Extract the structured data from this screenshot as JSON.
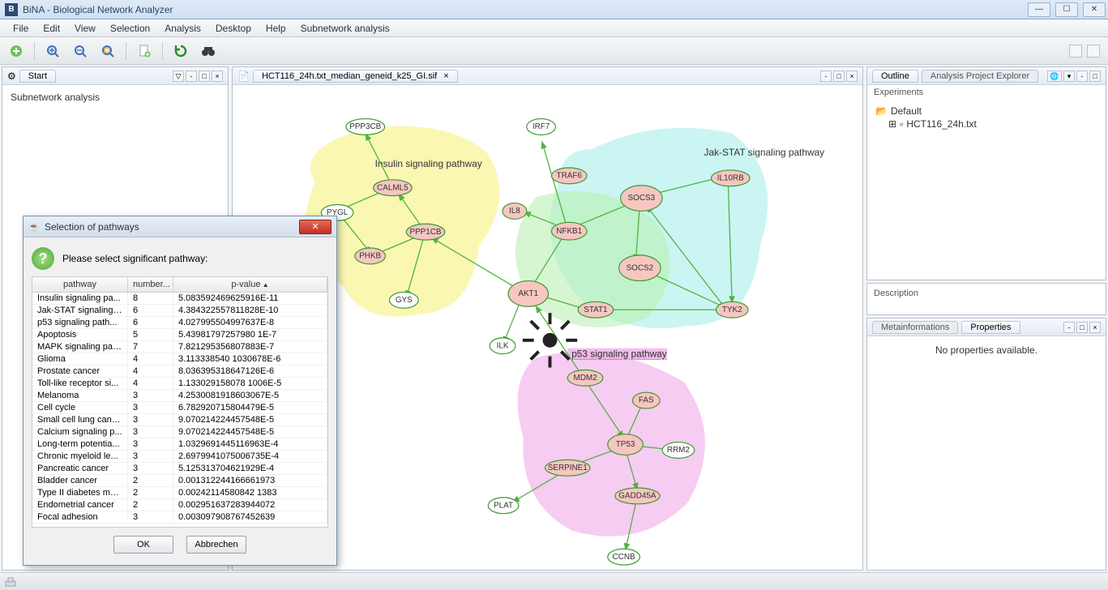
{
  "app": {
    "title": "BiNA - Biological Network Analyzer"
  },
  "menubar": {
    "items": [
      "File",
      "Edit",
      "View",
      "Selection",
      "Analysis",
      "Desktop",
      "Help",
      "Subnetwork analysis"
    ]
  },
  "left": {
    "tab": "Start",
    "body": "Subnetwork analysis"
  },
  "center": {
    "tab": "HCT116_24h.txt_median_geneid_k25_GI.sif"
  },
  "right": {
    "tabs": {
      "outline": "Outline",
      "analysis": "Analysis Project Explorer"
    },
    "experiments_label": "Experiments",
    "tree": {
      "default": "Default",
      "file": "HCT116_24h.txt"
    },
    "description_label": "Description",
    "properties_tabs": {
      "meta": "Metainformations",
      "props": "Properties"
    },
    "properties_body": "No properties available."
  },
  "dialog": {
    "title": "Selection of pathways",
    "prompt": "Please select significant pathway:",
    "columns": {
      "pathway": "pathway",
      "number": "number...",
      "pvalue": "p-value"
    },
    "rows": [
      {
        "pathway": "Insulin signaling pa...",
        "number": "8",
        "pvalue": "5.083592469625916E-11"
      },
      {
        "pathway": "Jak-STAT signaling ...",
        "number": "6",
        "pvalue": "4.384322557811828E-10"
      },
      {
        "pathway": "p53 signaling path...",
        "number": "6",
        "pvalue": "4.027995504997637E-8"
      },
      {
        "pathway": "Apoptosis",
        "number": "5",
        "pvalue": "5.43981797257980 1E-7"
      },
      {
        "pathway": "MAPK signaling pat...",
        "number": "7",
        "pvalue": "7.821295356807883E-7"
      },
      {
        "pathway": "Glioma",
        "number": "4",
        "pvalue": "3.113338540 1030678E-6"
      },
      {
        "pathway": "Prostate cancer",
        "number": "4",
        "pvalue": "8.036395318647126E-6"
      },
      {
        "pathway": "Toll-like receptor si...",
        "number": "4",
        "pvalue": "1.133029158078 1006E-5"
      },
      {
        "pathway": "Melanoma",
        "number": "3",
        "pvalue": "4.2530081918603067E-5"
      },
      {
        "pathway": "Cell cycle",
        "number": "3",
        "pvalue": "6.782920715804479E-5"
      },
      {
        "pathway": "Small cell lung canc...",
        "number": "3",
        "pvalue": "9.070214224457548E-5"
      },
      {
        "pathway": "Calcium signaling p...",
        "number": "3",
        "pvalue": "9.070214224457548E-5"
      },
      {
        "pathway": "Long-term potentia...",
        "number": "3",
        "pvalue": "1.0329691445116963E-4"
      },
      {
        "pathway": "Chronic myeloid le...",
        "number": "3",
        "pvalue": "2.6979941075006735E-4"
      },
      {
        "pathway": "Pancreatic cancer",
        "number": "3",
        "pvalue": "5.125313704621929E-4"
      },
      {
        "pathway": "Bladder cancer",
        "number": "2",
        "pvalue": "0.001312244166661973"
      },
      {
        "pathway": "Type II diabetes mel...",
        "number": "2",
        "pvalue": "0.00242114580842 1383"
      },
      {
        "pathway": "Endometrial cancer",
        "number": "2",
        "pvalue": "0.002951637283944072"
      },
      {
        "pathway": "Focal adhesion",
        "number": "3",
        "pvalue": "0.003097908767452639"
      }
    ],
    "ok": "OK",
    "cancel": "Abbrechen"
  },
  "network": {
    "regions": {
      "insulin": "Insulin signaling pathway",
      "jakstat": "Jak-STAT signaling pathway",
      "p53": "p53 signaling pathway"
    },
    "nodes": {
      "PPP3CB": "PPP3CB",
      "IRF7": "IRF7",
      "CALML5": "CALML5",
      "TRAF6": "TRAF6",
      "SOCS3": "SOCS3",
      "IL10RB": "IL10RB",
      "PYGL": "PYGL",
      "IL8": "IL8",
      "PPP1CB": "PPP1CB",
      "NFKB1": "NFKB1",
      "PHKB": "PHKB",
      "SOCS2": "SOCS2",
      "GYS": "GYS",
      "AKT1": "AKT1",
      "STAT1": "STAT1",
      "TYK2": "TYK2",
      "ILK": "ILK",
      "MDM2": "MDM2",
      "FAS": "FAS",
      "TP53": "TP53",
      "RRM2": "RRM2",
      "SERPINE1": "SERPINE1",
      "GADD45A": "GADD45A",
      "PLAT": "PLAT",
      "CCNB": "CCNB"
    }
  }
}
